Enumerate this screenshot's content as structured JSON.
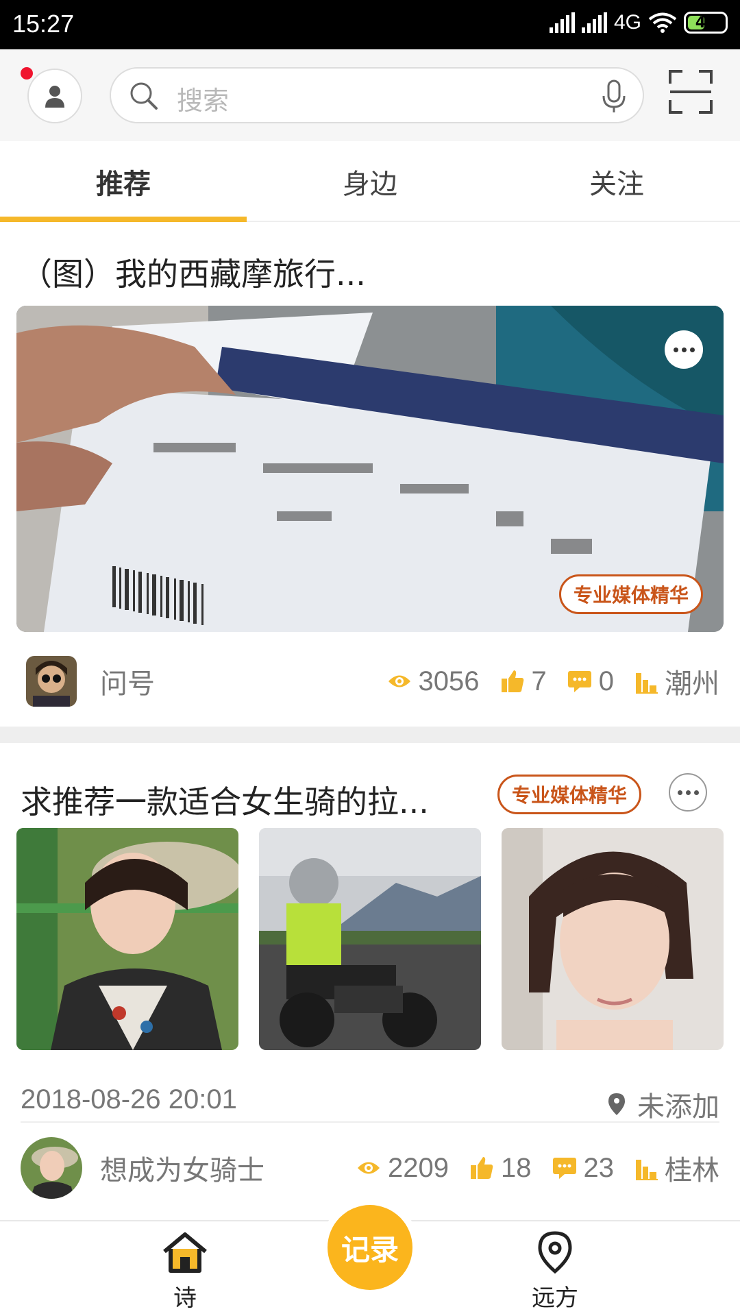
{
  "status_bar": {
    "time": "15:27",
    "network": "4G",
    "battery": "47"
  },
  "search": {
    "placeholder": "搜索"
  },
  "tabs": [
    {
      "label": "推荐",
      "active": true
    },
    {
      "label": "身边",
      "active": false
    },
    {
      "label": "关注",
      "active": false
    }
  ],
  "posts": [
    {
      "title": "（图）我的西藏摩旅行...",
      "badge": "专业媒体精华",
      "author": "问号",
      "views": "3056",
      "likes": "7",
      "comments": "0",
      "city": "潮州"
    },
    {
      "title": "求推荐一款适合女生骑的拉...",
      "badge": "专业媒体精华",
      "date": "2018-08-26 20:01",
      "location": "未添加",
      "author": "想成为女骑士",
      "views": "2209",
      "likes": "18",
      "comments": "23",
      "city": "桂林"
    }
  ],
  "bottom_nav": {
    "home_label": "诗",
    "record_label": "记录",
    "distance_label": "远方"
  },
  "colors": {
    "accent": "#f5b82a",
    "badge": "#c9551a",
    "notify": "#f0142e"
  }
}
